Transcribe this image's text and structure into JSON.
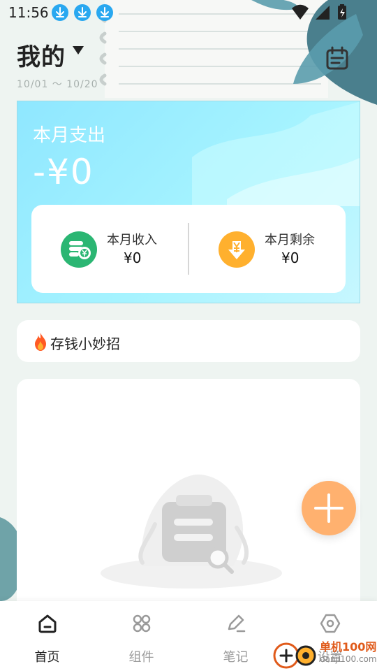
{
  "status_bar": {
    "time": "11:56"
  },
  "header": {
    "title": "我的",
    "date_range": "10/01 ～ 10/20"
  },
  "summary": {
    "month_label": "本月支出",
    "month_amount": "-¥0",
    "income_label": "本月收入",
    "income_value": "¥0",
    "remain_label": "本月剩余",
    "remain_value": "¥0"
  },
  "tips": {
    "text": "存钱小妙招"
  },
  "bottom_nav": {
    "items": [
      {
        "label": "首页",
        "icon": "home-icon",
        "active": true
      },
      {
        "label": "组件",
        "icon": "grid-icon",
        "active": false
      },
      {
        "label": "笔记",
        "icon": "edit-icon",
        "active": false
      },
      {
        "label": "设置",
        "icon": "settings-icon",
        "active": false
      }
    ]
  },
  "watermark": {
    "line1": "单机100网",
    "line2": "danji100.com"
  },
  "colors": {
    "card_bg": "#9fefff",
    "income_icon": "#2bb673",
    "remain_icon": "#ffb02e",
    "fab": "#ffb16f"
  }
}
